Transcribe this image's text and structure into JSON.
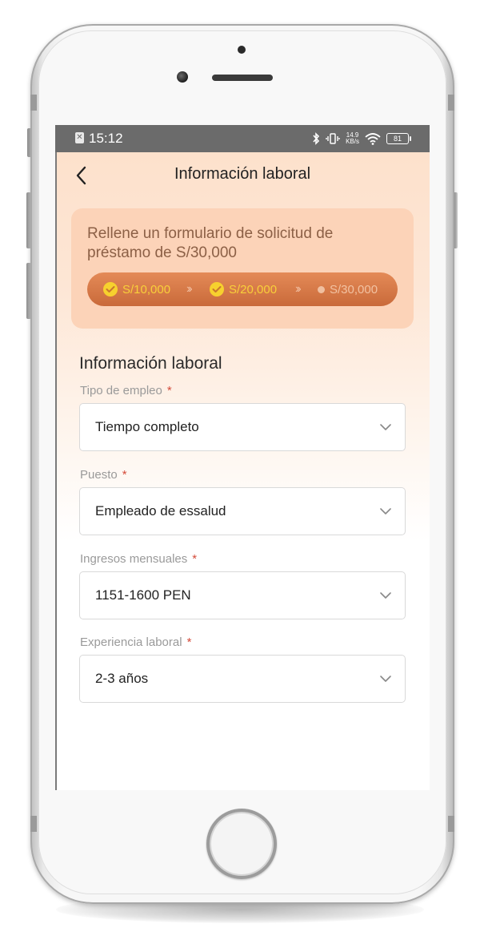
{
  "status_bar": {
    "time": "15:12",
    "net_speed_value": "14.9",
    "net_speed_unit": "KB/s",
    "battery": "81",
    "icons": [
      "sim-icon",
      "bluetooth-icon",
      "vibrate-icon",
      "wifi-icon",
      "battery-icon"
    ]
  },
  "header": {
    "title": "Información laboral",
    "back_icon": "chevron-left-icon"
  },
  "promo": {
    "text": "Rellene un formulario de solicitud de préstamo de S/30,000",
    "steps": [
      {
        "label": "S/10,000",
        "state": "done"
      },
      {
        "label": "S/20,000",
        "state": "done"
      },
      {
        "label": "S/30,000",
        "state": "pending"
      }
    ],
    "colors": {
      "done": "#f7d12e",
      "pill": "#d57846"
    }
  },
  "form": {
    "section_title": "Información laboral",
    "required_mark": "*",
    "fields": [
      {
        "label": "Tipo de empleo",
        "value": "Tiempo completo"
      },
      {
        "label": "Puesto",
        "value": "Empleado de essalud"
      },
      {
        "label": "Ingresos mensuales",
        "value": "1151-1600 PEN"
      },
      {
        "label": "Experiencia laboral",
        "value": "2-3 años"
      }
    ]
  }
}
